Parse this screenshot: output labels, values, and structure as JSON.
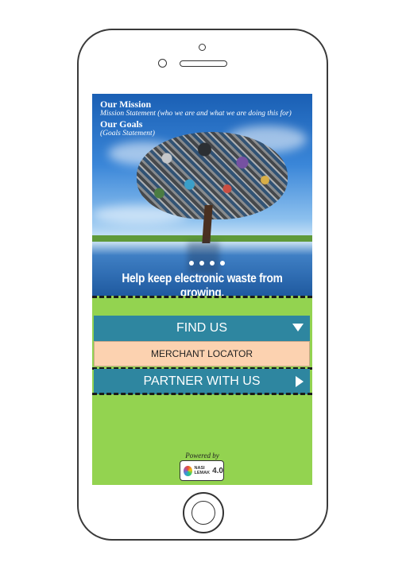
{
  "hero": {
    "mission_heading": "Our Mission",
    "mission_text": "Mission Statement (who we are and what we are doing this for)",
    "goals_heading": "Our Goals",
    "goals_text": "(Goals Statement)",
    "tagline": "Help keep electronic waste from growing.",
    "slide_count": 4
  },
  "nav": {
    "find_us_label": "FIND US",
    "merchant_locator_label": "MERCHANT LOCATOR",
    "partner_label": "PARTNER WITH US"
  },
  "footer": {
    "powered_by": "Powered by",
    "logo_line1": "NASI",
    "logo_line2": "LEMAK",
    "logo_version": "4.0"
  },
  "colors": {
    "screen_bg": "#93d350",
    "bar_bg": "#2e86a0",
    "merchant_bg": "#fcd2b0"
  }
}
